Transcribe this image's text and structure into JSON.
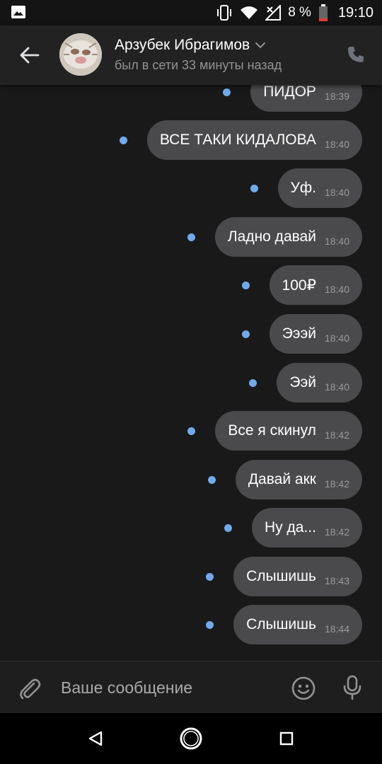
{
  "status_bar": {
    "battery_text": "8 %",
    "clock": "19:10",
    "icons": [
      "image-notification-icon",
      "vibrate-icon",
      "wifi-icon",
      "no-signal-icon",
      "battery-low-icon"
    ]
  },
  "header": {
    "contact_name": "Арзубек Ибрагимов",
    "contact_status": "был в сети 33 минуты назад",
    "icons": [
      "back-arrow-icon",
      "chevron-down-icon",
      "phone-icon"
    ]
  },
  "messages": [
    {
      "text": "ПИДОР",
      "time": "18:39"
    },
    {
      "text": "ВСЕ ТАКИ КИДАЛОВА",
      "time": "18:40"
    },
    {
      "text": "Уф.",
      "time": "18:40"
    },
    {
      "text": "Ладно давай",
      "time": "18:40"
    },
    {
      "text": "100₽",
      "time": "18:40"
    },
    {
      "text": "Эээй",
      "time": "18:40"
    },
    {
      "text": "Ээй",
      "time": "18:40"
    },
    {
      "text": "Все я скинул",
      "time": "18:42"
    },
    {
      "text": "Давай акк",
      "time": "18:42"
    },
    {
      "text": "Ну да...",
      "time": "18:42"
    },
    {
      "text": "Слышишь",
      "time": "18:43"
    },
    {
      "text": "Слышишь",
      "time": "18:44"
    }
  ],
  "composer": {
    "placeholder": "Ваше сообщение",
    "icons": [
      "paperclip-icon",
      "emoji-icon",
      "microphone-icon"
    ]
  },
  "nav_bar": {
    "icons": [
      "back-triangle-icon",
      "home-circle-icon",
      "recents-square-icon"
    ]
  },
  "colors": {
    "background": "#19191a",
    "bubble": "#4a4a4c",
    "unread_dot": "#71aaeb",
    "header": "#222223"
  }
}
